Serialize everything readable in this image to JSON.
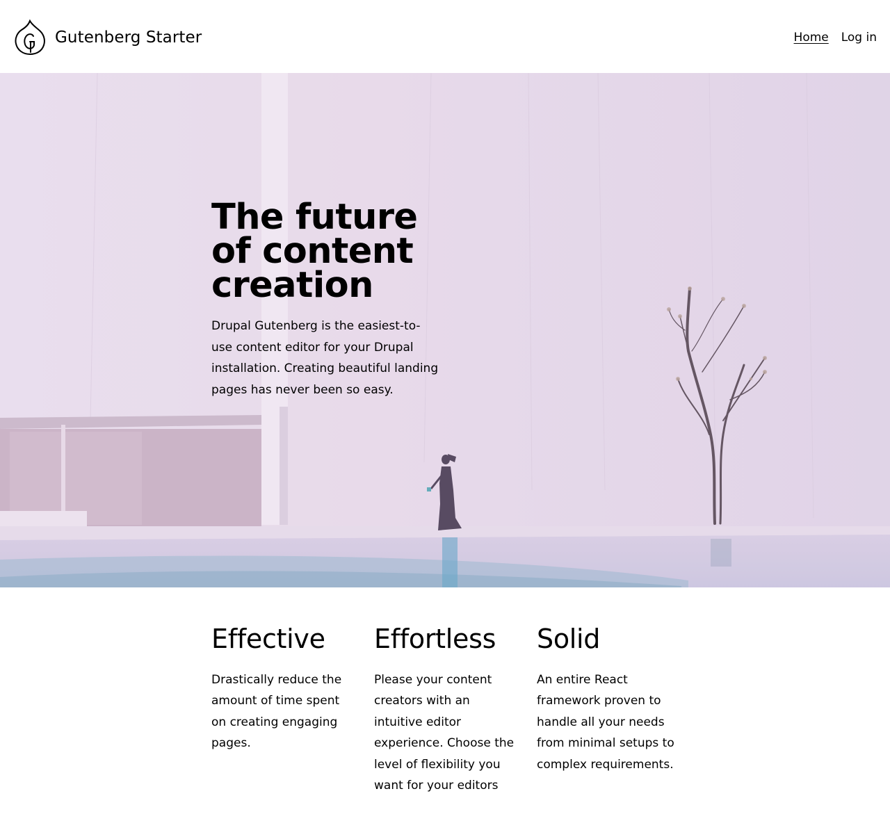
{
  "site": {
    "name": "Gutenberg Starter",
    "logo_icon": "drupal-drop-g-icon"
  },
  "nav": {
    "items": [
      {
        "label": "Home",
        "active": true
      },
      {
        "label": "Log in",
        "active": false
      }
    ]
  },
  "hero": {
    "title_lines": [
      "The future",
      "of content",
      "creation"
    ],
    "text": "Drupal Gutenberg is the easiest-to-use content editor for your Drupal installation. Creating beautiful landing pages has never been so easy.",
    "background_color": "#e3d6ea"
  },
  "features": [
    {
      "title": "Effective",
      "text": "Drastically reduce the amount of time spent on creating engaging pages."
    },
    {
      "title": "Effortless",
      "text": "Please your content creators with an intuitive editor experience. Choose the level of flexibility you want for your editors"
    },
    {
      "title": "Solid",
      "text": "An entire React framework proven to handle all your needs from minimal setups to complex requirements."
    }
  ]
}
